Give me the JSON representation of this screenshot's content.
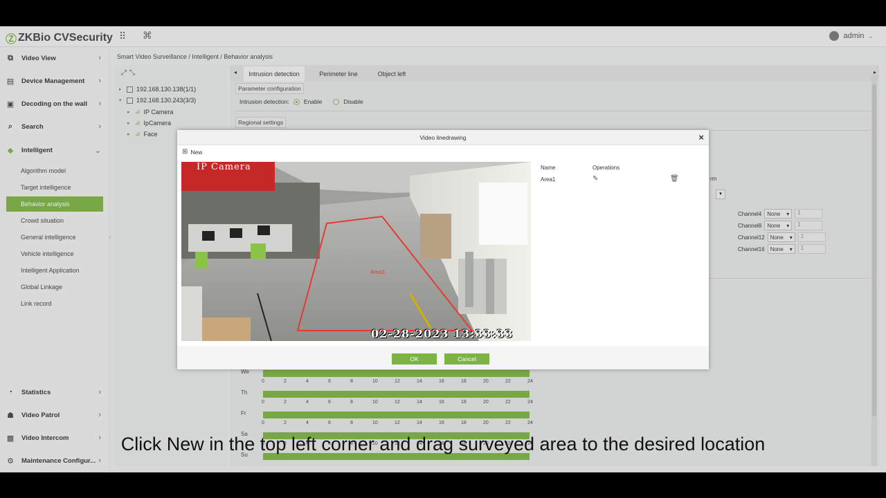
{
  "app": {
    "logo_mark": "Ⓩ",
    "brand": "ZKBio CVSecurity",
    "user": "admin"
  },
  "sidebar": {
    "items": [
      {
        "label": "Video View",
        "icon": "video-view-icon"
      },
      {
        "label": "Device Management",
        "icon": "device-icon"
      },
      {
        "label": "Decoding on the wall",
        "icon": "decoding-icon"
      },
      {
        "label": "Search",
        "icon": "search-icon"
      },
      {
        "label": "Intelligent",
        "icon": "intelligent-icon"
      }
    ],
    "sub_items": [
      "Algorithm model",
      "Target intelligence",
      "Behavior analysis",
      "Crowd situation",
      "General intelligence",
      "Vehicle intelligence",
      "Intelligent Application",
      "Global Linkage",
      "Link record"
    ],
    "bottom_items": [
      {
        "label": "Statistics",
        "icon": "statistics-icon"
      },
      {
        "label": "Video Patrol",
        "icon": "patrol-icon"
      },
      {
        "label": "Video Intercom",
        "icon": "intercom-icon"
      },
      {
        "label": "Maintenance Configur...",
        "icon": "maintenance-icon"
      }
    ]
  },
  "breadcrumb": "Smart Video Surveillance / Intelligent / Behavior analysis",
  "tree": {
    "nodes": [
      {
        "label": "192.168.130.138(1/1)"
      },
      {
        "label": "192.168.130.243(3/3)"
      },
      {
        "label": "IP Camera"
      },
      {
        "label": "IpCamera"
      },
      {
        "label": "Face"
      }
    ]
  },
  "tabs": [
    "Intrusion detection",
    "Perimeter line",
    "Object left"
  ],
  "params": {
    "section1": "Parameter configuration",
    "detection_label": "Intrusion detection:",
    "enable": "Enable",
    "disable": "Disable",
    "section2": "Regional settings",
    "partial_text": "rm"
  },
  "channels": [
    {
      "name": "Channel4",
      "sel": "None",
      "num": "1"
    },
    {
      "name": "Channel8",
      "sel": "None",
      "num": "1"
    },
    {
      "name": "Channel12",
      "sel": "None",
      "num": "1"
    },
    {
      "name": "Channel16",
      "sel": "None",
      "num": "1"
    }
  ],
  "schedule": {
    "days": [
      "We",
      "Th",
      "Fr",
      "Sa",
      "Su"
    ],
    "ticks": [
      "0",
      "2",
      "4",
      "6",
      "8",
      "10",
      "12",
      "14",
      "16",
      "18",
      "20",
      "22",
      "24"
    ]
  },
  "modal": {
    "title": "Video linedrawing",
    "close": "×",
    "new_label": "New",
    "camera_label": "IP Camera",
    "timestamp": "02-28-2023  13:33:33",
    "area_tag": "Area1",
    "col_name": "Name",
    "col_ops": "Operations",
    "rows": [
      {
        "name": "Area1"
      }
    ],
    "ok": "OK",
    "cancel": "Cancel"
  },
  "caption": "Click New in the top left corner and drag surveyed area to the desired location",
  "colors": {
    "accent": "#7cb342",
    "area_line": "#e53935"
  }
}
